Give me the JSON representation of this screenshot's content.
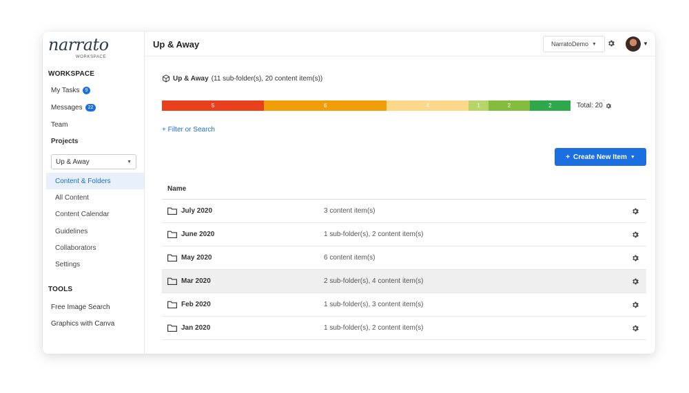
{
  "logo": {
    "text": "narrato",
    "sub": "WORKSPACE"
  },
  "sidebar": {
    "workspace_heading": "WORKSPACE",
    "my_tasks": {
      "label": "My Tasks",
      "badge": "9"
    },
    "messages": {
      "label": "Messages",
      "badge": "22"
    },
    "team": "Team",
    "projects": "Projects",
    "project_select": "Up & Away",
    "project_links": [
      "Content & Folders",
      "All Content",
      "Content Calendar",
      "Guidelines",
      "Collaborators",
      "Settings"
    ],
    "tools_heading": "TOOLS",
    "tools": [
      "Free Image Search",
      "Graphics with Canva"
    ]
  },
  "header": {
    "title": "Up & Away",
    "account": "NarratoDemo"
  },
  "folder": {
    "name": "Up & Away",
    "summary": "(11 sub-folder(s), 20 content item(s))"
  },
  "progress": {
    "segments": [
      {
        "value": 5,
        "color": "#e8401c"
      },
      {
        "value": 6,
        "color": "#f09d0a"
      },
      {
        "value": 4,
        "color": "#fcd98a"
      },
      {
        "value": 1,
        "color": "#b6d46a"
      },
      {
        "value": 2,
        "color": "#84bc3e"
      },
      {
        "value": 2,
        "color": "#2ea84a"
      }
    ],
    "total_label": "Total: 20"
  },
  "actions": {
    "filter": "+ Filter or Search",
    "create": "Create New Item"
  },
  "table": {
    "header": "Name",
    "rows": [
      {
        "name": "July 2020",
        "count": "3 content item(s)",
        "highlight": false
      },
      {
        "name": "June 2020",
        "count": "1 sub-folder(s), 2 content item(s)",
        "highlight": false
      },
      {
        "name": "May 2020",
        "count": "6 content item(s)",
        "highlight": false
      },
      {
        "name": "Mar 2020",
        "count": "2 sub-folder(s), 4 content item(s)",
        "highlight": true
      },
      {
        "name": "Feb 2020",
        "count": "1 sub-folder(s), 3 content item(s)",
        "highlight": false
      },
      {
        "name": "Jan 2020",
        "count": "1 sub-folder(s), 2 content item(s)",
        "highlight": false
      }
    ]
  },
  "colors": {
    "accent": "#1b6fe0"
  }
}
